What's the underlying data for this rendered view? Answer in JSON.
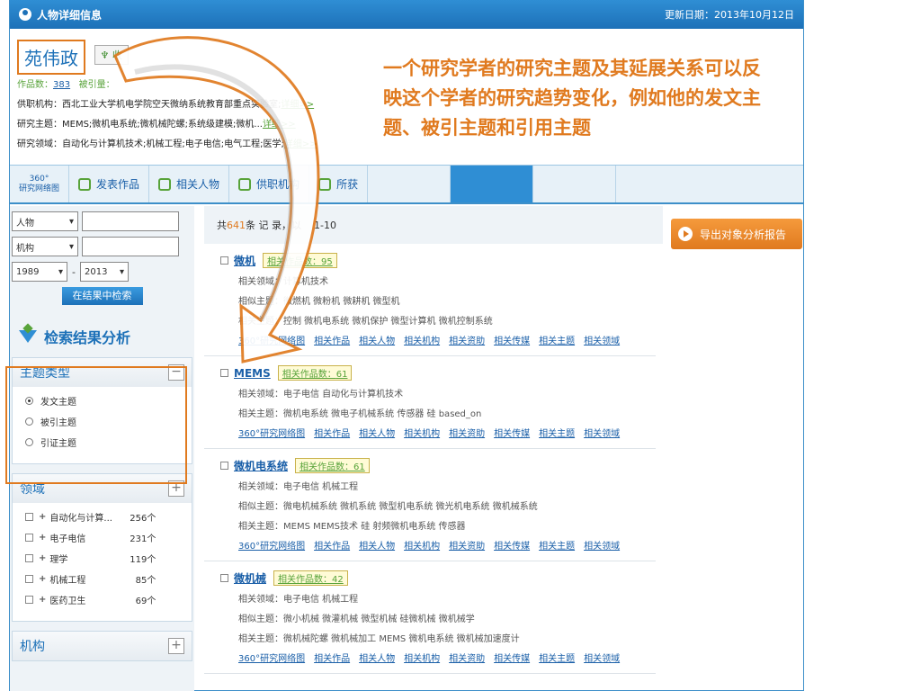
{
  "window": {
    "title": "人物详细信息",
    "update_date": "更新日期：2013年10月12日"
  },
  "profile": {
    "name": "苑伟政",
    "follow_label": "收",
    "works_label": "作品数：",
    "works_count": "383",
    "cited_label": "被引量：",
    "affiliation": "供职机构：西北工业大学机电学院空天微纳系统教育部重点实验室;",
    "topics": "研究主题：MEMS;微机电系统;微机械陀螺;系统级建模;微机...",
    "fields": "研究领域：自动化与计算机技术;机械工程;电子电信;电气工程;医学;",
    "detail_link": "详细>>"
  },
  "annotation": "一个研究学者的研究主题及其延展关系可以反映这个学者的研究趋势变化，例如他的发文主题、被引主题和引用主题",
  "tabs": [
    {
      "label": "360°",
      "sublabel": "研究网络图"
    },
    {
      "label": "发表作品"
    },
    {
      "label": "相关人物"
    },
    {
      "label": "供职机构"
    },
    {
      "label": "所获"
    }
  ],
  "filters": {
    "person_select": "人物",
    "org_select": "机构",
    "year_from": "1989",
    "year_to": "2013",
    "year_sep": "-",
    "search_in_results": "在结果中检索"
  },
  "analysis": {
    "title": "检索结果分析",
    "topic_panel": {
      "title": "主题类型",
      "options": [
        "发文主题",
        "被引主题",
        "引证主题"
      ],
      "selected": 0
    },
    "field_panel": {
      "title": "领域",
      "items": [
        {
          "name": "自动化与计算...",
          "count": "256个"
        },
        {
          "name": "电子电信",
          "count": "231个"
        },
        {
          "name": "理学",
          "count": "119个"
        },
        {
          "name": "机械工程",
          "count": "85个"
        },
        {
          "name": "医药卫生",
          "count": "69个"
        }
      ]
    },
    "org_panel": {
      "title": "机构"
    }
  },
  "results": {
    "summary_prefix": "共 ",
    "total": "641",
    "summary_suffix": " 条 记 录，以",
    "summary_range": "1-10",
    "items": [
      {
        "title": "微机",
        "badge_label": "相关作品数：",
        "badge_count": "95",
        "lines": [
          "相关领域：计算机技术",
          "相似主题：微燃机 微粉机 微耕机 微型机",
          "相关主题：控制 微机电系统 微机保护 微型计算机 微机控制系统"
        ]
      },
      {
        "title": "MEMS",
        "badge_label": "相关作品数：",
        "badge_count": "61",
        "lines": [
          "相关领域：电子电信 自动化与计算机技术",
          "相关主题：微机电系统 微电子机械系统 传感器 硅 based_on"
        ]
      },
      {
        "title": "微机电系统",
        "badge_label": "相关作品数：",
        "badge_count": "61",
        "lines": [
          "相关领域：电子电信 机械工程",
          "相似主题：微电机械系统 微机系统 微型机电系统 微光机电系统 微机械系统",
          "相关主题：MEMS MEMS技术 硅 射频微机电系统 传感器"
        ]
      },
      {
        "title": "微机械",
        "badge_label": "相关作品数：",
        "badge_count": "42",
        "lines": [
          "相关领域：电子电信 机械工程",
          "相似主题：微小机械 微灌机械 微型机械 硅微机械 微机械学",
          "相关主题：微机械陀螺 微机械加工 MEMS 微机电系统 微机械加速度计"
        ]
      }
    ],
    "link_labels": [
      "360°研究网络图",
      "相关作品",
      "相关人物",
      "相关机构",
      "相关资助",
      "相关传媒",
      "相关主题",
      "相关领域"
    ]
  },
  "export_button": "导出对象分析报告",
  "colors": {
    "accent": "#e07a1f",
    "primary": "#1d71b8",
    "green": "#58a33a"
  }
}
